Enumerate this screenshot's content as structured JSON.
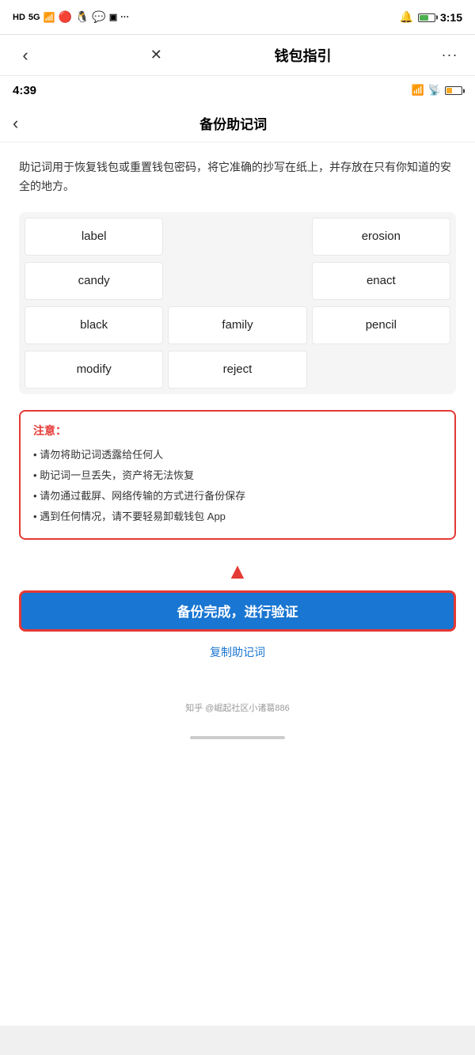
{
  "outer_status": {
    "left_label": "HD 5G",
    "time": "3:15",
    "icons": [
      "signal",
      "wifi",
      "battery"
    ]
  },
  "outer_nav": {
    "back_icon": "‹",
    "close_icon": "✕",
    "title": "钱包指引",
    "more_icon": "···"
  },
  "inner_status": {
    "time": "4:39"
  },
  "inner_nav": {
    "back_icon": "‹",
    "title": "备份助记词"
  },
  "description": "助记词用于恢复钱包或重置钱包密码，将它准确的抄写在纸上，并存放在只有你知道的安全的地方。",
  "mnemonic_words": [
    [
      "label",
      "",
      "erosion"
    ],
    [
      "candy",
      "",
      "enact"
    ],
    [
      "black",
      "family",
      "pencil"
    ],
    [
      "modify",
      "reject",
      ""
    ]
  ],
  "warning": {
    "title": "注意：",
    "items": [
      "• 请勿将助记词透露给任何人",
      "• 助记词一旦丢失，资产将无法恢复",
      "• 请勿通过截屏、网络传输的方式进行备份保存",
      "• 遇到任何情况，请不要轻易卸载钱包 App"
    ]
  },
  "action_button": {
    "label": "备份完成，进行验证"
  },
  "copy_link": {
    "label": "复制助记词"
  },
  "attribution": {
    "text": "知乎 @崛起社区小诸葛886"
  }
}
